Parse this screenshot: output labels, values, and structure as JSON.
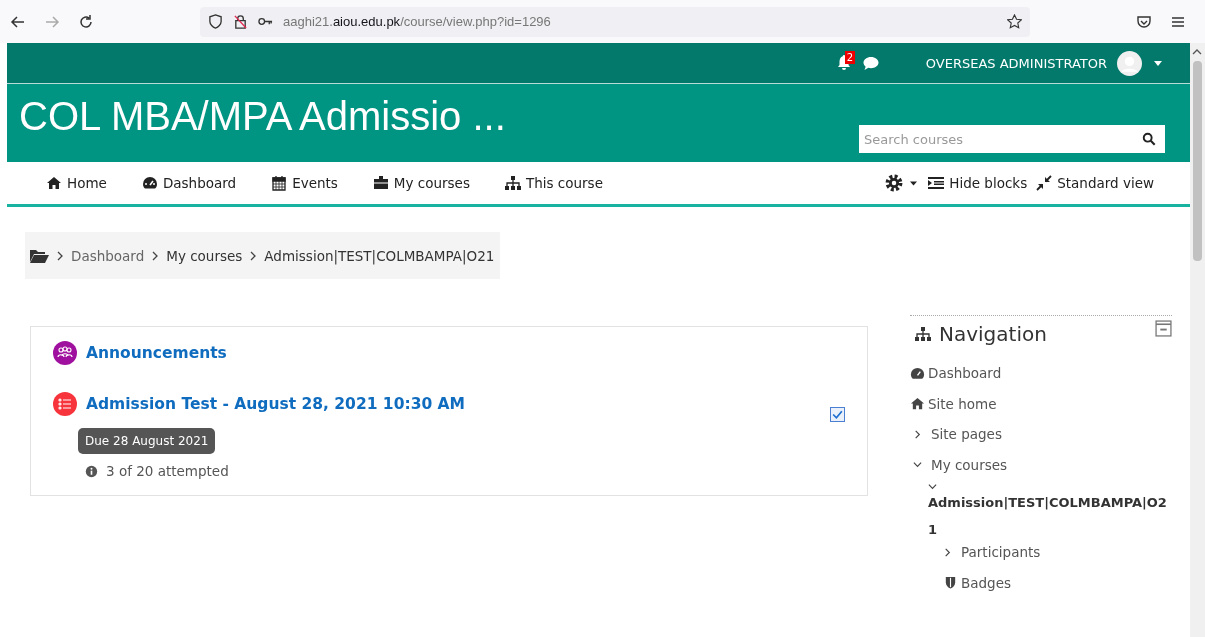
{
  "browser": {
    "url_host_prefix": "aaghi21.",
    "url_host": "aiou.edu.pk",
    "url_path": "/course/view.php?id=1296"
  },
  "topbar": {
    "notification_count": "2",
    "user": "OVERSEAS ADMINISTRATOR"
  },
  "header": {
    "title": "COL MBA/MPA Admissio ...",
    "search": {
      "placeholder": "Search courses"
    }
  },
  "nav": [
    {
      "kind": "home",
      "label": "Home"
    },
    {
      "kind": "dashboard",
      "label": "Dashboard"
    },
    {
      "kind": "calendar",
      "label": "Events"
    },
    {
      "kind": "briefcase",
      "label": "My courses"
    },
    {
      "kind": "sitemap",
      "label": "This course"
    }
  ],
  "nav_right": {
    "hide_blocks": "Hide blocks",
    "standard_view": "Standard view"
  },
  "breadcrumb": [
    "Dashboard",
    "My courses",
    "Admission|TEST|COLMBAMPA|O21"
  ],
  "activities": [
    {
      "kind": "forum",
      "color": "#a0109e",
      "title": "Announcements"
    },
    {
      "kind": "quiz",
      "color": "#f7343c",
      "title": "Admission Test - August 28, 2021 10:30 AM",
      "checked": true,
      "due": "Due 28 August 2021",
      "info": "3 of 20 attempted"
    }
  ],
  "navigation_block": {
    "title": "Navigation",
    "items": [
      {
        "kind": "dashboard",
        "label": "Dashboard"
      },
      {
        "kind": "home",
        "label": "Site home"
      },
      {
        "kind": "branch",
        "label": "Site pages",
        "expanded": false
      },
      {
        "kind": "branch",
        "label": "My courses",
        "expanded": true,
        "children": [
          {
            "kind": "course",
            "label": "Admission|TEST|COLMBAMPA|O21",
            "expanded": true,
            "children": [
              {
                "kind": "branch",
                "label": "Participants",
                "expanded": false
              },
              {
                "kind": "badge",
                "label": "Badges"
              }
            ]
          }
        ]
      }
    ]
  }
}
